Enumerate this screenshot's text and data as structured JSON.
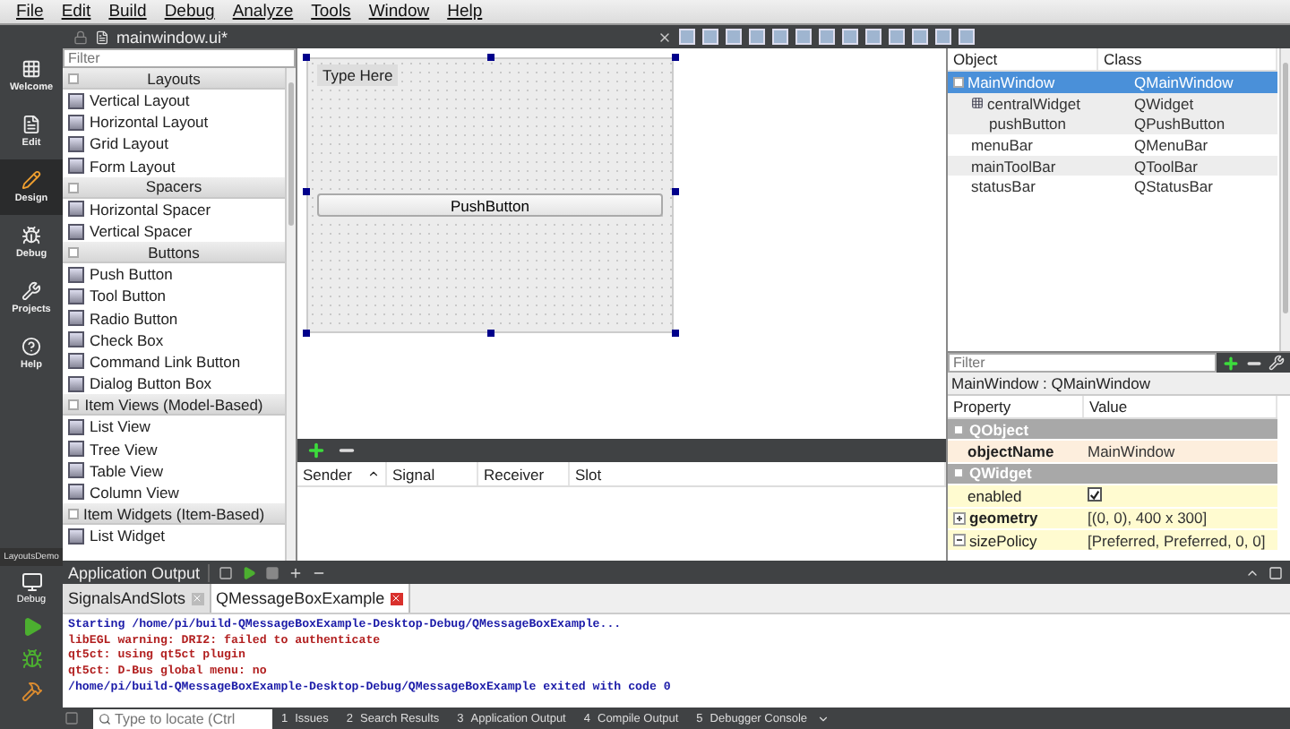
{
  "menu": [
    "File",
    "Edit",
    "Build",
    "Debug",
    "Analyze",
    "Tools",
    "Window",
    "Help"
  ],
  "modes": [
    {
      "label": "Welcome",
      "selected": false
    },
    {
      "label": "Edit",
      "selected": false
    },
    {
      "label": "Design",
      "selected": true
    },
    {
      "label": "Debug",
      "selected": false
    },
    {
      "label": "Projects",
      "selected": false
    },
    {
      "label": "Help",
      "selected": false
    }
  ],
  "kit": {
    "project": "LayoutsDemo",
    "label": "Debug"
  },
  "document": {
    "title": "mainwindow.ui*"
  },
  "widget_box": {
    "placeholder": "Filter",
    "categories": [
      {
        "title": "Layouts",
        "items": [
          "Vertical Layout",
          "Horizontal Layout",
          "Grid Layout",
          "Form Layout"
        ]
      },
      {
        "title": "Spacers",
        "items": [
          "Horizontal Spacer",
          "Vertical Spacer"
        ]
      },
      {
        "title": "Buttons",
        "items": [
          "Push Button",
          "Tool Button",
          "Radio Button",
          "Check Box",
          "Command Link Button",
          "Dialog Button Box"
        ]
      },
      {
        "title": "Item Views (Model-Based)",
        "items": [
          "List View",
          "Tree View",
          "Table View",
          "Column View"
        ]
      },
      {
        "title": "Item Widgets (Item-Based)",
        "items": [
          "List Widget"
        ]
      }
    ]
  },
  "form": {
    "menu_placeholder": "Type Here",
    "button": "PushButton"
  },
  "signal_slot": {
    "columns": [
      "Sender",
      "Signal",
      "Receiver",
      "Slot"
    ]
  },
  "object_inspector": {
    "columns": [
      "Object",
      "Class"
    ],
    "rows": [
      {
        "name": "MainWindow",
        "class": "QMainWindow",
        "selected": true,
        "children": [
          {
            "name": "centralWidget",
            "class": "QWidget",
            "selected": false,
            "children": [
              {
                "name": "pushButton",
                "class": "QPushButton",
                "selected": false
              }
            ]
          },
          {
            "name": "menuBar",
            "class": "QMenuBar",
            "selected": false
          },
          {
            "name": "mainToolBar",
            "class": "QToolBar",
            "selected": false
          },
          {
            "name": "statusBar",
            "class": "QStatusBar",
            "selected": false
          }
        ]
      }
    ]
  },
  "property_editor": {
    "placeholder": "Filter",
    "title": "MainWindow : QMainWindow",
    "columns": [
      "Property",
      "Value"
    ],
    "rows": [
      {
        "kind": "group",
        "name": "QObject"
      },
      {
        "kind": "text",
        "name": "objectName",
        "value": "MainWindow",
        "bold": true,
        "expandable": false
      },
      {
        "kind": "group",
        "name": "QWidget"
      },
      {
        "kind": "check",
        "name": "enabled",
        "checked": true,
        "bold": false
      },
      {
        "kind": "text",
        "name": "geometry",
        "value": "[(0, 0), 400 x 300]",
        "bold": true,
        "expandable": true,
        "expanded": false
      },
      {
        "kind": "text",
        "name": "sizePolicy",
        "value": "[Preferred, Preferred, 0, 0]",
        "bold": false,
        "expandable": true,
        "expanded": true
      }
    ]
  },
  "output": {
    "title": "Application Output",
    "tabs": [
      {
        "label": "SignalsAndSlots",
        "selected": false
      },
      {
        "label": "QMessageBoxExample",
        "selected": true
      }
    ],
    "lines": [
      {
        "kind": "info",
        "text": "Starting /home/pi/build-QMessageBoxExample-Desktop-Debug/QMessageBoxExample..."
      },
      {
        "kind": "error",
        "text": "libEGL warning: DRI2: failed to authenticate"
      },
      {
        "kind": "error",
        "text": "qt5ct: using qt5ct plugin"
      },
      {
        "kind": "error",
        "text": "qt5ct: D-Bus global menu: no"
      },
      {
        "kind": "info",
        "text": "/home/pi/build-QMessageBoxExample-Desktop-Debug/QMessageBoxExample exited with code 0"
      }
    ]
  },
  "status_bar": {
    "placeholder": "Type to locate (Ctrl",
    "panes": [
      {
        "number": "1",
        "label": "Issues"
      },
      {
        "number": "2",
        "label": "Search Results"
      },
      {
        "number": "3",
        "label": "Application Output"
      },
      {
        "number": "4",
        "label": "Compile Output"
      },
      {
        "number": "5",
        "label": "Debugger Console"
      }
    ]
  }
}
